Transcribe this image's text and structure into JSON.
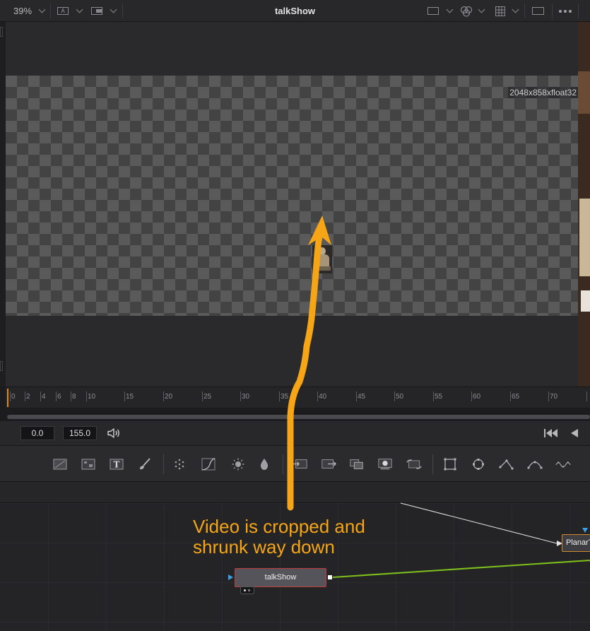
{
  "viewer_toolbar": {
    "zoom": "39%",
    "channel_label": "A",
    "title": "talkShow"
  },
  "viewer": {
    "resolution": "2048x858xfloat32"
  },
  "ruler": {
    "ticks": [
      "0",
      "2",
      "4",
      "6",
      "8",
      "10",
      "15",
      "20",
      "25",
      "30",
      "35",
      "40",
      "45",
      "50",
      "55",
      "60",
      "65",
      "70"
    ]
  },
  "transport": {
    "current_time": "0.0",
    "end_time": "155.0"
  },
  "node_graph": {
    "selected_node": "talkShow",
    "other_node": "PlanarT"
  },
  "annotation": {
    "line1": "Video is cropped and",
    "line2": "shrunk way down"
  },
  "colors": {
    "annotation": "#f5a516",
    "playhead": "#e08a1e",
    "node_selected_border": "#c43b3b",
    "connection_green": "#7fbf1c"
  }
}
